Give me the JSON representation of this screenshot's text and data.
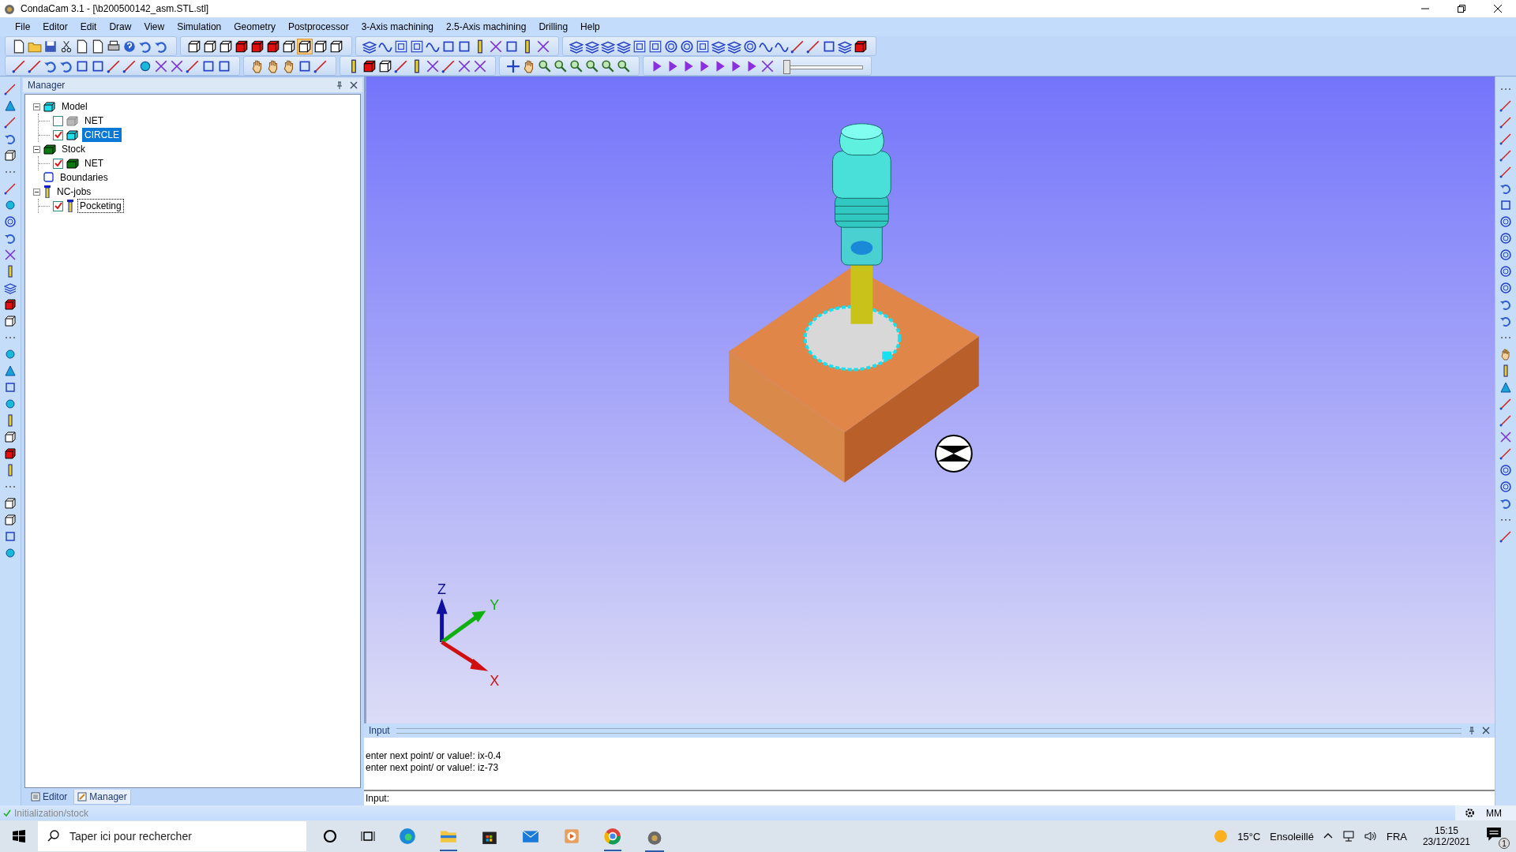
{
  "window": {
    "title": "CondaCam 3.1 - [\\b200500142_asm.STL.stl]"
  },
  "menu": [
    "File",
    "Editor",
    "Edit",
    "Draw",
    "View",
    "Simulation",
    "Geometry",
    "Postprocessor",
    "3-Axis machining",
    "2.5-Axis machining",
    "Drilling",
    "Help"
  ],
  "simulation_slider": {
    "level": 0
  },
  "manager": {
    "title": "Manager",
    "tree": [
      {
        "label": "Model",
        "kind": "model",
        "expanded": true,
        "children": [
          {
            "label": "NET",
            "kind": "model",
            "checked": false,
            "selected": false,
            "focused": false
          },
          {
            "label": "CIRCLE",
            "kind": "model",
            "checked": true,
            "selected": true,
            "focused": false
          }
        ]
      },
      {
        "label": "Stock",
        "kind": "stock",
        "expanded": true,
        "children": [
          {
            "label": "NET",
            "kind": "stock",
            "checked": true,
            "selected": false,
            "focused": false
          }
        ]
      },
      {
        "label": "Boundaries",
        "kind": "boundary"
      },
      {
        "label": "NC-jobs",
        "kind": "job",
        "expanded": true,
        "children": [
          {
            "label": "Pocketing",
            "kind": "job",
            "checked": true,
            "selected": false,
            "focused": true
          }
        ]
      }
    ]
  },
  "panel_tabs": [
    {
      "label": "Editor",
      "selected": false
    },
    {
      "label": "Manager",
      "selected": true
    }
  ],
  "viewport": {
    "axes": {
      "z": "Z",
      "y": "Y",
      "x": "X"
    }
  },
  "input_panel": {
    "title": "Input",
    "lines": [
      "enter next point/ or value!: ix-0.4",
      "enter next point/ or value!: iz-73"
    ],
    "prompt": "Input:"
  },
  "status_bar": {
    "message": "Initialization/stock",
    "units": "MM"
  },
  "taskbar": {
    "search": {
      "placeholder": "Taper ici pour rechercher"
    },
    "temperature": "15°C",
    "weather": "Ensoleillé",
    "language": "FRA",
    "time": "15:15",
    "date": "23/12/2021",
    "notifications": "1"
  }
}
